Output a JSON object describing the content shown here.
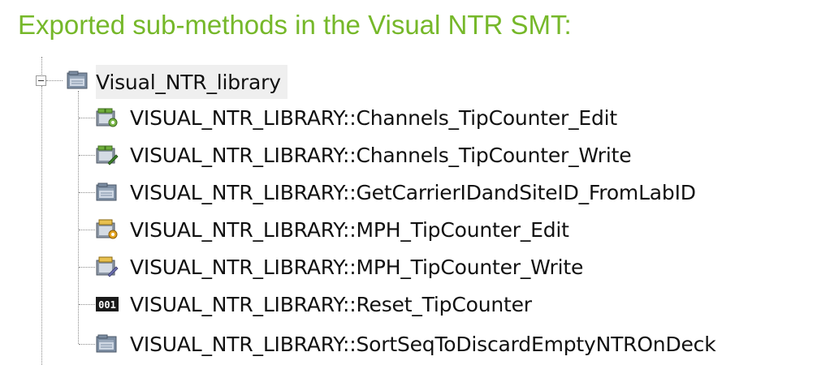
{
  "heading": "Exported sub-methods in the Visual NTR SMT:",
  "tree": {
    "root": {
      "label": "Visual_NTR_library",
      "icon": "library-icon",
      "expanded": true
    },
    "items": [
      {
        "label": "VISUAL_NTR_LIBRARY::Channels_TipCounter_Edit",
        "icon": "channels-edit-icon"
      },
      {
        "label": "VISUAL_NTR_LIBRARY::Channels_TipCounter_Write",
        "icon": "channels-write-icon"
      },
      {
        "label": "VISUAL_NTR_LIBRARY::GetCarrierIDandSiteID_FromLabID",
        "icon": "library-method-icon"
      },
      {
        "label": "VISUAL_NTR_LIBRARY::MPH_TipCounter_Edit",
        "icon": "mph-edit-icon"
      },
      {
        "label": "VISUAL_NTR_LIBRARY::MPH_TipCounter_Write",
        "icon": "mph-write-icon"
      },
      {
        "label": "VISUAL_NTR_LIBRARY::Reset_TipCounter",
        "icon": "binary-001-icon"
      },
      {
        "label": "VISUAL_NTR_LIBRARY::SortSeqToDiscardEmptyNTROnDeck",
        "icon": "library-method-icon"
      }
    ]
  },
  "colors": {
    "heading": "#76b82a",
    "selection": "#efefef",
    "text": "#111111"
  }
}
